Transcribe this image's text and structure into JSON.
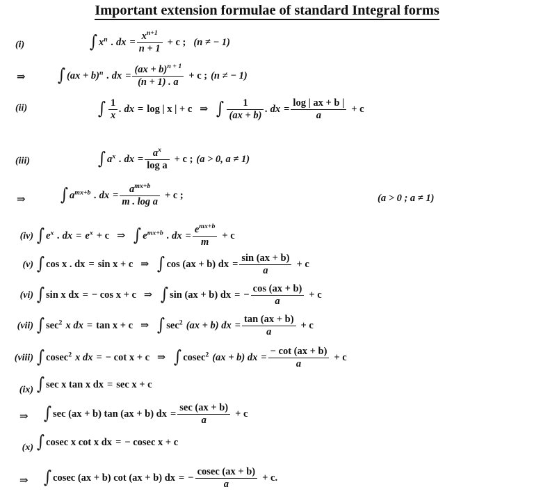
{
  "document": {
    "title": "Important extension formulae of standard Integral forms",
    "background_color": "#ffffff",
    "text_color": "#111111"
  },
  "labels": {
    "i": "(i)",
    "ii": "(ii)",
    "iii": "(iii)",
    "iv": "(iv)",
    "v": "(v)",
    "vi": "(vi)",
    "vii": "(vii)",
    "viii": "(viii)",
    "ix": "(ix)",
    "x": "(x)",
    "implies": "⇒"
  },
  "formulas": {
    "i": {
      "label": "(i)",
      "text": "∫ xⁿ . dx = xⁿ⁺¹/(n+1) + c ;  (n ≠ − 1)",
      "parts": {
        "integrand_base": "x",
        "integrand_exp": "n",
        "dx": ". dx",
        "equals": "=",
        "num_base": "x",
        "num_exp": "n+1",
        "den": "n + 1",
        "plus_c": "+ c ;",
        "condition": "(n ≠ − 1)"
      }
    },
    "i_ext": {
      "label": "⇒",
      "parts": {
        "integrand": "(ax + b)",
        "integrand_exp": "n",
        "dx": ". dx",
        "equals": "=",
        "num": "(ax + b)",
        "num_exp": "n + 1",
        "den": "(n + 1) . a",
        "plus_c": "+ c ;",
        "condition": "(n ≠ − 1)"
      }
    },
    "ii": {
      "label": "(ii)",
      "parts": {
        "lhs_num": "1",
        "lhs_den": "x",
        "lhs_dx": ". dx",
        "lhs_equals": "=",
        "lhs_rhs": "log | x | + c",
        "implies": "⇒",
        "rhs_num": "1",
        "rhs_den": "(ax + b)",
        "rhs_dx": ". dx",
        "rhs_equals": "=",
        "res_num": "log | ax + b |",
        "res_den": "a",
        "plus_c": "+ c"
      }
    },
    "iii": {
      "label": "(iii)",
      "parts": {
        "base": "a",
        "exp": "x",
        "dx": ". dx",
        "equals": "=",
        "num_base": "a",
        "num_exp": "x",
        "den": "log a",
        "plus_c": "+ c ;",
        "condition": "(a > 0, a ≠ 1)"
      }
    },
    "iii_ext": {
      "label": "⇒",
      "parts": {
        "base": "a",
        "exp": "mx+b",
        "dx": ". dx",
        "equals": "=",
        "num_base": "a",
        "num_exp": "mx+b",
        "den": "m . log a",
        "plus_c": "+ c ;",
        "condition_right": "(a > 0 ; a ≠ 1)"
      }
    },
    "iv": {
      "label": "(iv)",
      "parts": {
        "lhs_base": "e",
        "lhs_exp": "x",
        "lhs_dx": ". dx",
        "lhs_equals": "=",
        "lhs_res_base": "e",
        "lhs_res_exp": "x",
        "lhs_plus_c": "+ c",
        "implies": "⇒",
        "rhs_base": "e",
        "rhs_exp": "mx+b",
        "rhs_dx": ". dx",
        "rhs_equals": "=",
        "num_base": "e",
        "num_exp": "mx+b",
        "den": "m",
        "plus_c": "+ c"
      }
    },
    "v": {
      "label": "(v)",
      "parts": {
        "lhs": "cos x . dx",
        "lhs_equals": "=",
        "lhs_res": "sin x + c",
        "implies": "⇒",
        "rhs": "cos (ax + b) dx",
        "rhs_equals": "=",
        "num": "sin (ax + b)",
        "den": "a",
        "plus_c": "+ c"
      }
    },
    "vi": {
      "label": "(vi)",
      "parts": {
        "lhs": "sin x dx",
        "lhs_equals": "=",
        "lhs_res": "− cos x + c",
        "implies": "⇒",
        "rhs": "sin (ax + b) dx",
        "rhs_equals": "=",
        "sign": "−",
        "num": "cos (ax + b)",
        "den": "a",
        "plus_c": "+ c"
      }
    },
    "vii": {
      "label": "(vii)",
      "parts": {
        "lhs_fn": "sec",
        "lhs_exp": "2",
        "lhs_var": "x dx",
        "lhs_equals": "=",
        "lhs_res": "tan x + c",
        "implies": "⇒",
        "rhs_fn": "sec",
        "rhs_exp": "2",
        "rhs_arg": "(ax + b) dx",
        "rhs_equals": "=",
        "num": "tan (ax + b)",
        "den": "a",
        "plus_c": "+ c"
      }
    },
    "viii": {
      "label": "(viii)",
      "parts": {
        "lhs_fn": "cosec",
        "lhs_exp": "2",
        "lhs_var": "x dx",
        "lhs_equals": "=",
        "lhs_res": "− cot x + c",
        "implies": "⇒",
        "rhs_fn": "cosec",
        "rhs_exp": "2",
        "rhs_arg": "(ax + b) dx",
        "rhs_equals": "=",
        "num": "− cot (ax + b)",
        "den": "a",
        "plus_c": "+ c"
      }
    },
    "ix": {
      "label": "(ix)",
      "parts": {
        "lhs": "sec x tan x dx",
        "equals": "=",
        "res": "sec x + c"
      }
    },
    "ix_ext": {
      "label": "⇒",
      "parts": {
        "lhs": "sec (ax + b) tan (ax + b) dx",
        "equals": "=",
        "num": "sec (ax + b)",
        "den": "a",
        "plus_c": "+ c"
      }
    },
    "x": {
      "label": "(x)",
      "parts": {
        "lhs": "cosec x cot x dx",
        "equals": "=",
        "res": "− cosec x + c"
      }
    },
    "x_ext": {
      "label": "⇒",
      "parts": {
        "lhs": "cosec (ax + b) cot (ax + b) dx",
        "equals": "=",
        "sign": "−",
        "num": "cosec (ax + b)",
        "den": "a",
        "plus_c": "+ c."
      }
    }
  }
}
